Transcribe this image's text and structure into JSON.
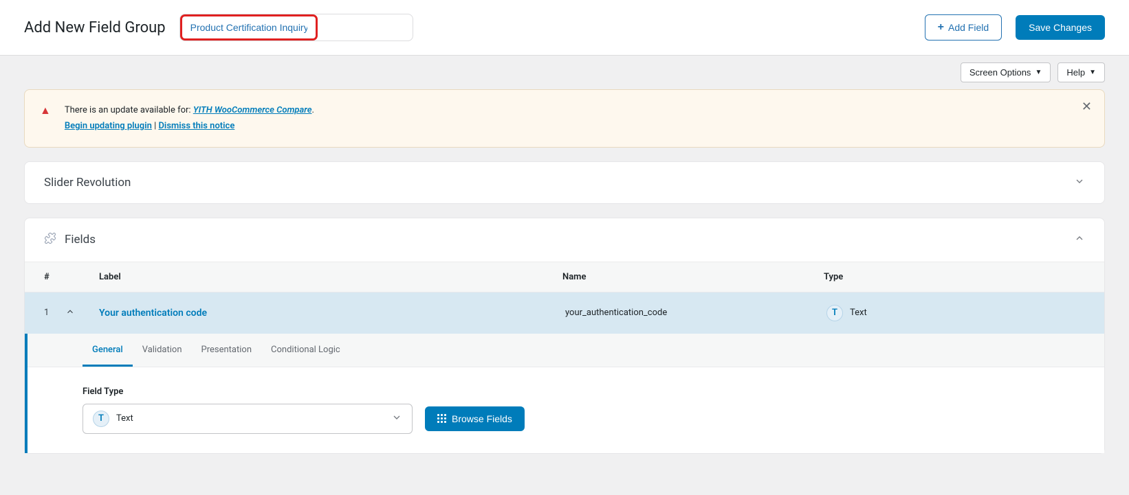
{
  "header": {
    "page_title": "Add New Field Group",
    "title_input_value": "Product Certification Inquiry",
    "add_field_label": "Add Field",
    "save_label": "Save Changes"
  },
  "meta": {
    "screen_options_label": "Screen Options",
    "help_label": "Help"
  },
  "notice": {
    "prefix": "There is an update available for: ",
    "plugin_name": "YITH WooCommerce Compare",
    "suffix": ".",
    "begin_update_label": "Begin updating plugin",
    "separator": " | ",
    "dismiss_label": "Dismiss this notice"
  },
  "slider_panel": {
    "title": "Slider Revolution"
  },
  "fields_panel": {
    "title": "Fields",
    "columns": {
      "num": "#",
      "label": "Label",
      "name": "Name",
      "type": "Type"
    },
    "rows": [
      {
        "num": "1",
        "label": "Your authentication code",
        "name": "your_authentication_code",
        "type_label": "Text",
        "type_badge": "T"
      }
    ]
  },
  "editor": {
    "tabs": [
      "General",
      "Validation",
      "Presentation",
      "Conditional Logic"
    ],
    "active_tab": "General",
    "field_type_label": "Field Type",
    "field_type_value": "Text",
    "field_type_badge": "T",
    "browse_label": "Browse Fields"
  }
}
